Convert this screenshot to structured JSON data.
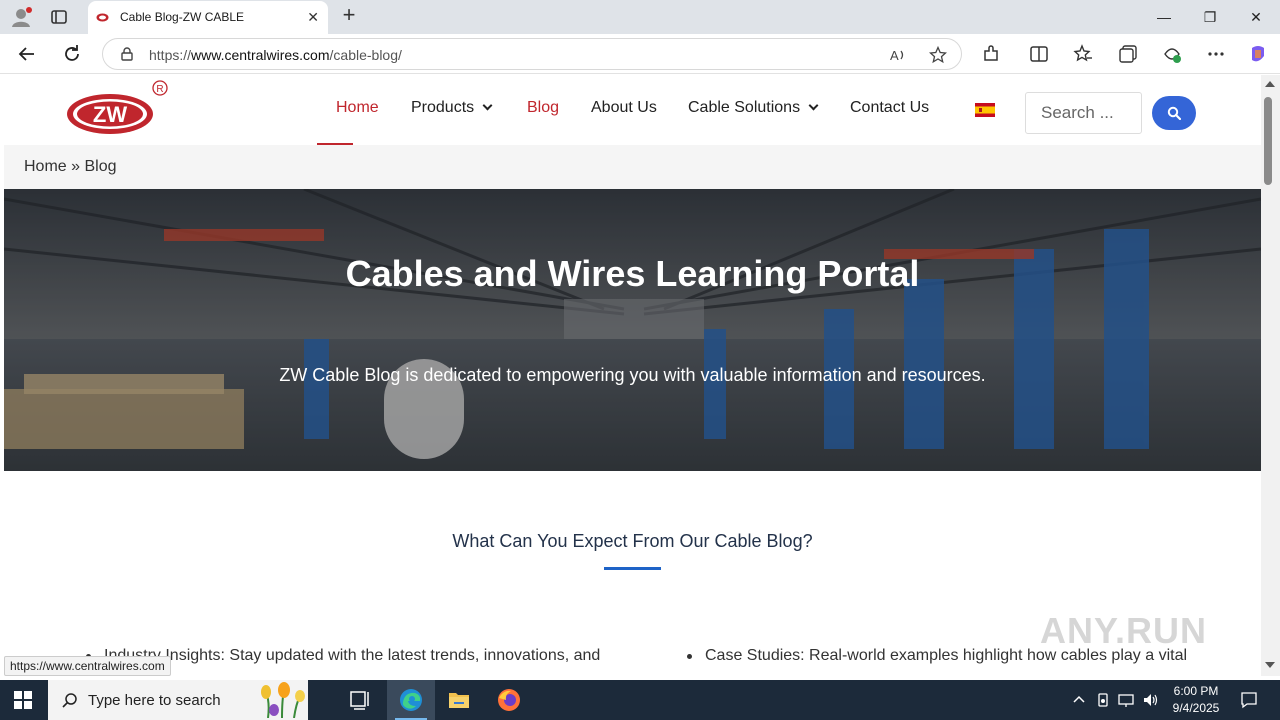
{
  "browser": {
    "tab_title": "Cable Blog-ZW CABLE",
    "tab_close": "✕",
    "new_tab": "+",
    "url_prefix": "https://",
    "url_domain": "www.centralwires.com",
    "url_path": "/cable-blog/",
    "status_url": "https://www.centralwires.com",
    "window_controls": {
      "minimize": "—",
      "restore": "❐",
      "close": "✕"
    }
  },
  "site": {
    "logo_text": "ZW",
    "registered_mark": "R",
    "nav": [
      {
        "label": "Home",
        "active": true
      },
      {
        "label": "Products",
        "dropdown": true
      },
      {
        "label": "Blog",
        "active": true
      },
      {
        "label": "About Us"
      },
      {
        "label": "Cable Solutions",
        "dropdown": true
      },
      {
        "label": "Contact Us"
      }
    ],
    "search_placeholder": "Search ...",
    "brand_color": "#c0262d",
    "accent_color": "#3465d7"
  },
  "breadcrumb": {
    "home": "Home",
    "separator": " » ",
    "current": "Blog"
  },
  "hero": {
    "title": "Cables and Wires Learning Portal",
    "subtitle": "ZW Cable Blog is dedicated to empowering you with valuable information and resources."
  },
  "section": {
    "title": "What Can You Expect From Our Cable Blog?",
    "bullets": [
      "Industry Insights: Stay updated with the latest trends, innovations, and",
      "Case Studies: Real-world examples highlight how cables play a vital"
    ]
  },
  "watermark": "ANY.RUN",
  "taskbar": {
    "search_placeholder": "Type here to search",
    "time": "6:00 PM",
    "date": "9/4/2025"
  }
}
